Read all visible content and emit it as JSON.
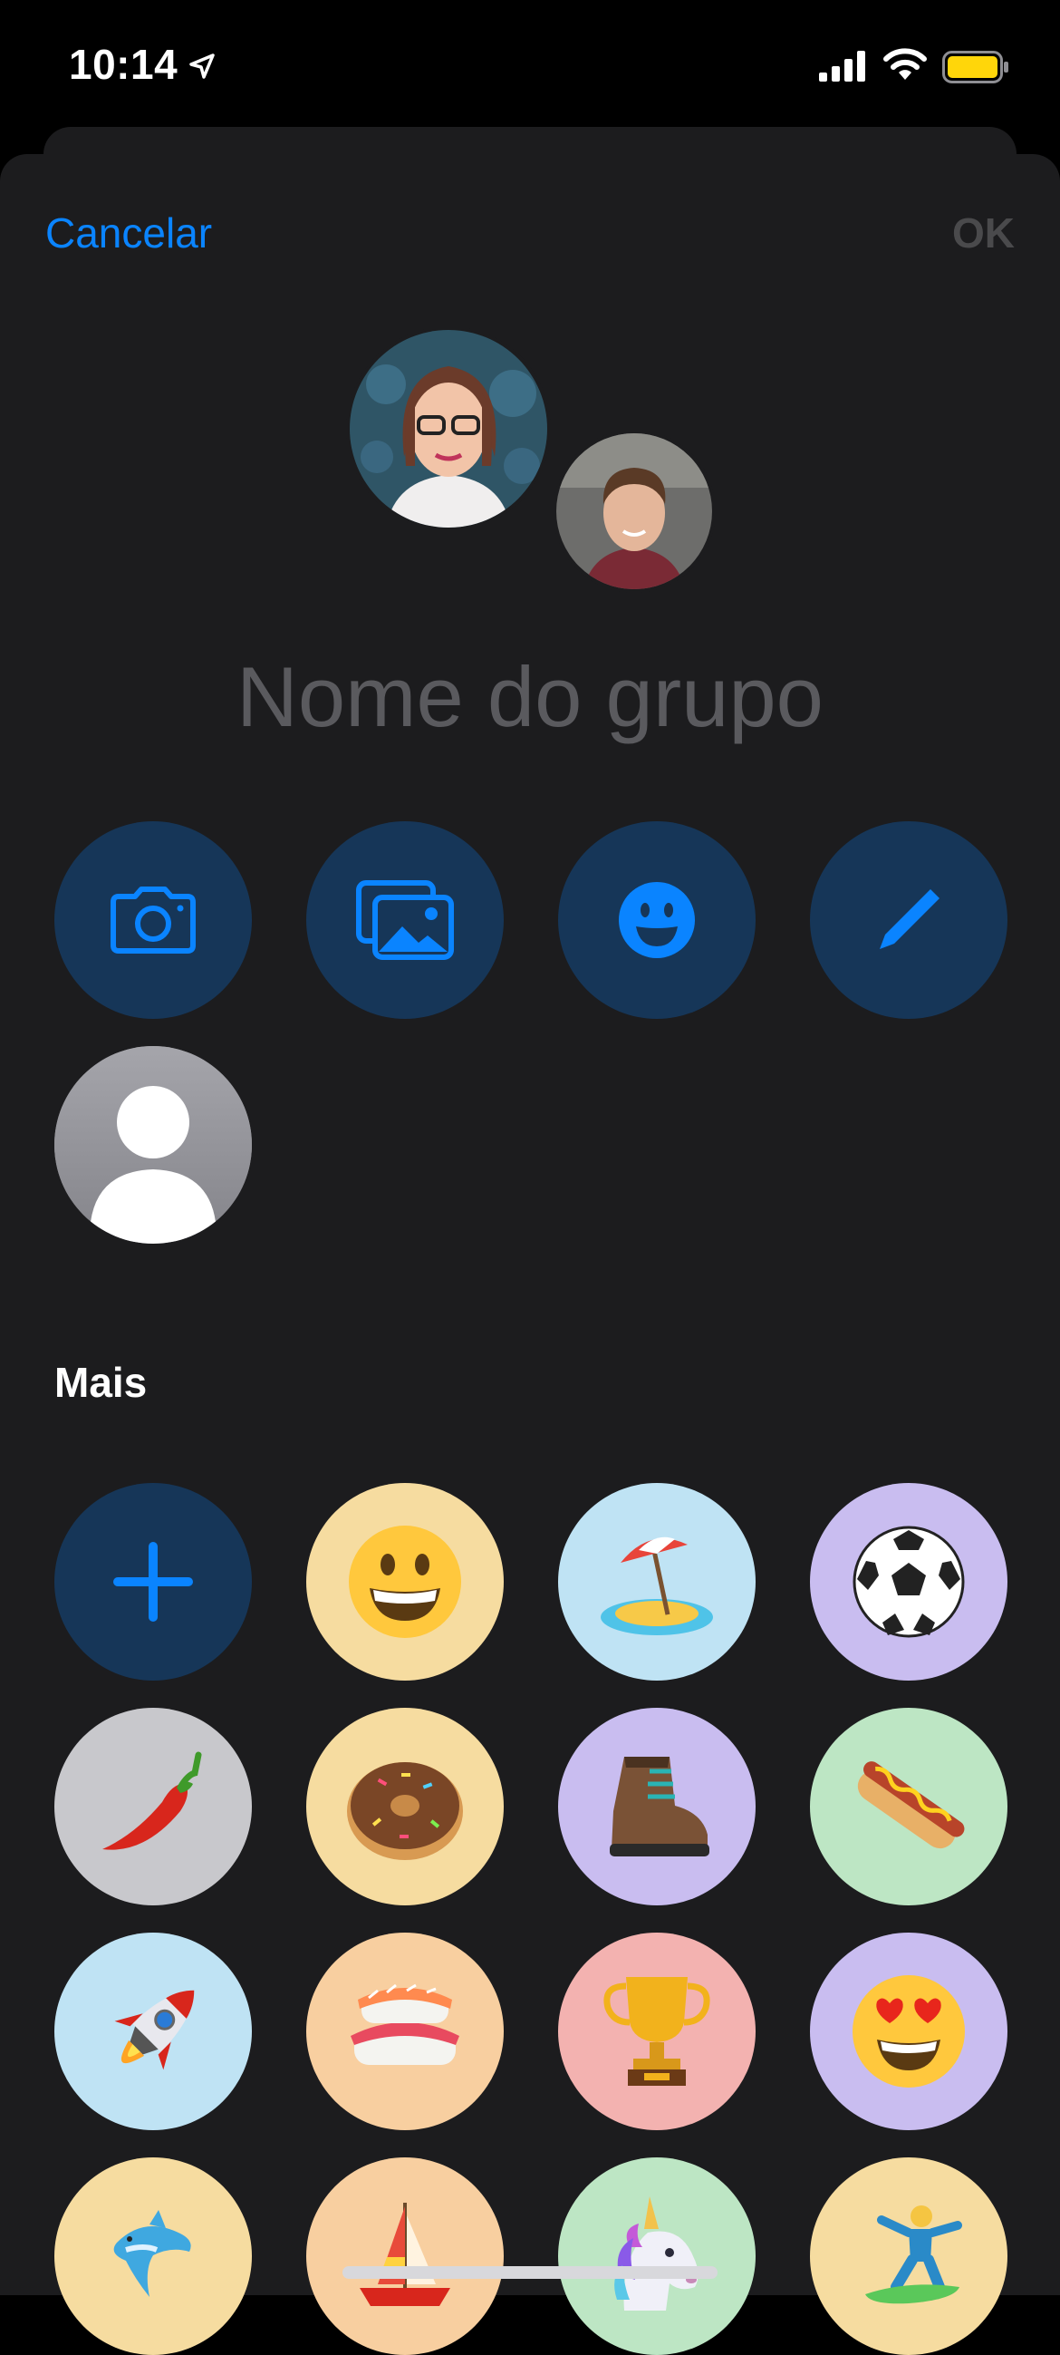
{
  "status_bar": {
    "time": "10:14"
  },
  "header": {
    "cancel_label": "Cancelar",
    "ok_label": "OK"
  },
  "group_name": {
    "placeholder": "Nome do grupo"
  },
  "actions": [
    {
      "name": "camera-icon"
    },
    {
      "name": "photos-icon"
    },
    {
      "name": "emoji-icon"
    },
    {
      "name": "pencil-icon"
    }
  ],
  "more_section": {
    "label": "Mais"
  },
  "emoji_grid": [
    {
      "name": "add",
      "bg": "#163658"
    },
    {
      "name": "grinning-face",
      "bg": "#f6dca0"
    },
    {
      "name": "beach-umbrella",
      "bg": "#bfe3f4"
    },
    {
      "name": "soccer-ball",
      "bg": "#c9bdf0"
    },
    {
      "name": "hot-pepper",
      "bg": "#c8c8cc"
    },
    {
      "name": "doughnut",
      "bg": "#f6dca0"
    },
    {
      "name": "hiking-boot",
      "bg": "#c9bdf0"
    },
    {
      "name": "hot-dog",
      "bg": "#bde6c4"
    },
    {
      "name": "rocket",
      "bg": "#bfe3f4"
    },
    {
      "name": "sushi",
      "bg": "#f8cfa0"
    },
    {
      "name": "trophy",
      "bg": "#f3b2b0"
    },
    {
      "name": "heart-eyes-face",
      "bg": "#c9bdf0"
    },
    {
      "name": "dolphin",
      "bg": "#f6dca0"
    },
    {
      "name": "sailboat",
      "bg": "#f8cfa0"
    },
    {
      "name": "unicorn",
      "bg": "#bde6c4"
    },
    {
      "name": "surfer",
      "bg": "#f6dca0"
    }
  ],
  "colors": {
    "accent": "#0a84ff",
    "sheet_bg": "#1c1c1e",
    "disabled_text": "#4a4a4c",
    "placeholder_text": "#5a5a5e"
  }
}
